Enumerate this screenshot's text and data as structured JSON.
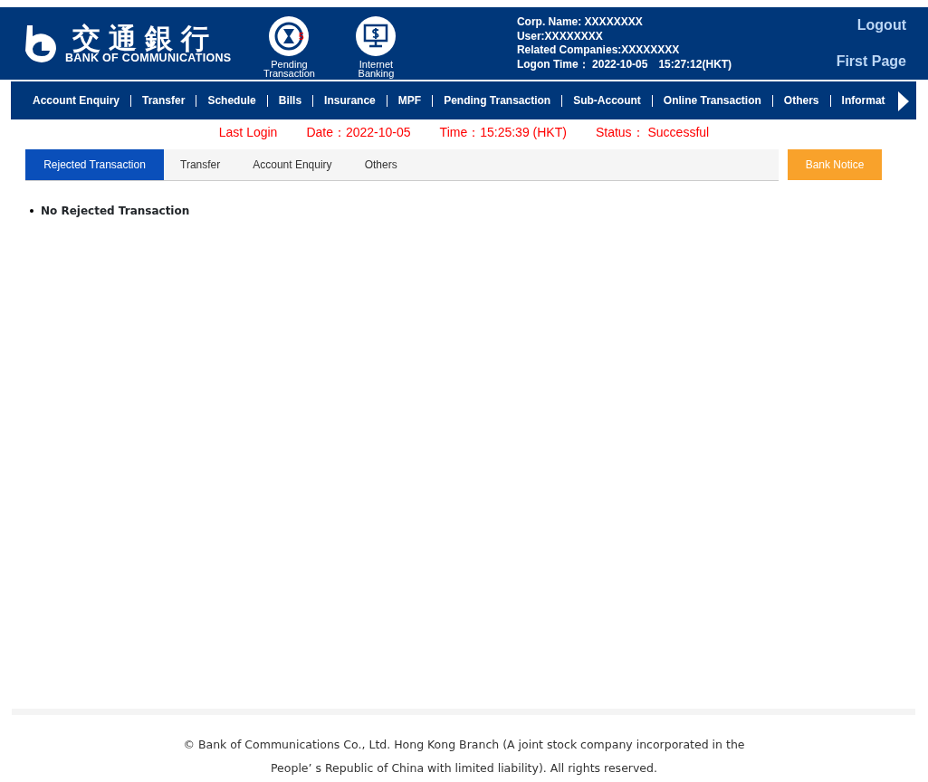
{
  "header": {
    "logo": {
      "chinese": "交通銀行",
      "english": "BANK OF COMMUNICATIONS"
    },
    "shortcuts": [
      {
        "kind": "pending",
        "label": "Pending Transaction",
        "badge": "5"
      },
      {
        "kind": "banking",
        "label": "Internet Banking"
      }
    ],
    "info": [
      "Corp. Name: XXXXXXXX",
      "User:XXXXXXXX",
      "Related Companies:XXXXXXXX",
      "Logon Time： 2022-10-05　15:27:12(HKT)"
    ],
    "links": [
      "Logout",
      "First Page"
    ]
  },
  "nav": {
    "items": [
      "Account Enquiry",
      "Transfer",
      "Schedule",
      "Bills",
      "Insurance",
      "MPF",
      "Pending Transaction",
      "Sub-Account",
      "Online Transaction",
      "Others",
      "Informat"
    ]
  },
  "last_login": [
    "Last Login",
    "Date：2022-10-05",
    "Time：15:25:39 (HKT)",
    "Status：  Successful"
  ],
  "tabs": [
    {
      "label": "Rejected Transaction",
      "selected": true
    },
    {
      "label": "Transfer",
      "selected": false
    },
    {
      "label": "Account Enquiry",
      "selected": false
    },
    {
      "label": "Others",
      "selected": false
    }
  ],
  "notice_button": "Bank Notice",
  "messages": [
    "No Rejected Transaction"
  ],
  "footer": "© Bank of Communications Co., Ltd. Hong Kong Branch (A joint stock company incorporated in the People’ s Republic of China with limited liability). All rights reserved."
}
